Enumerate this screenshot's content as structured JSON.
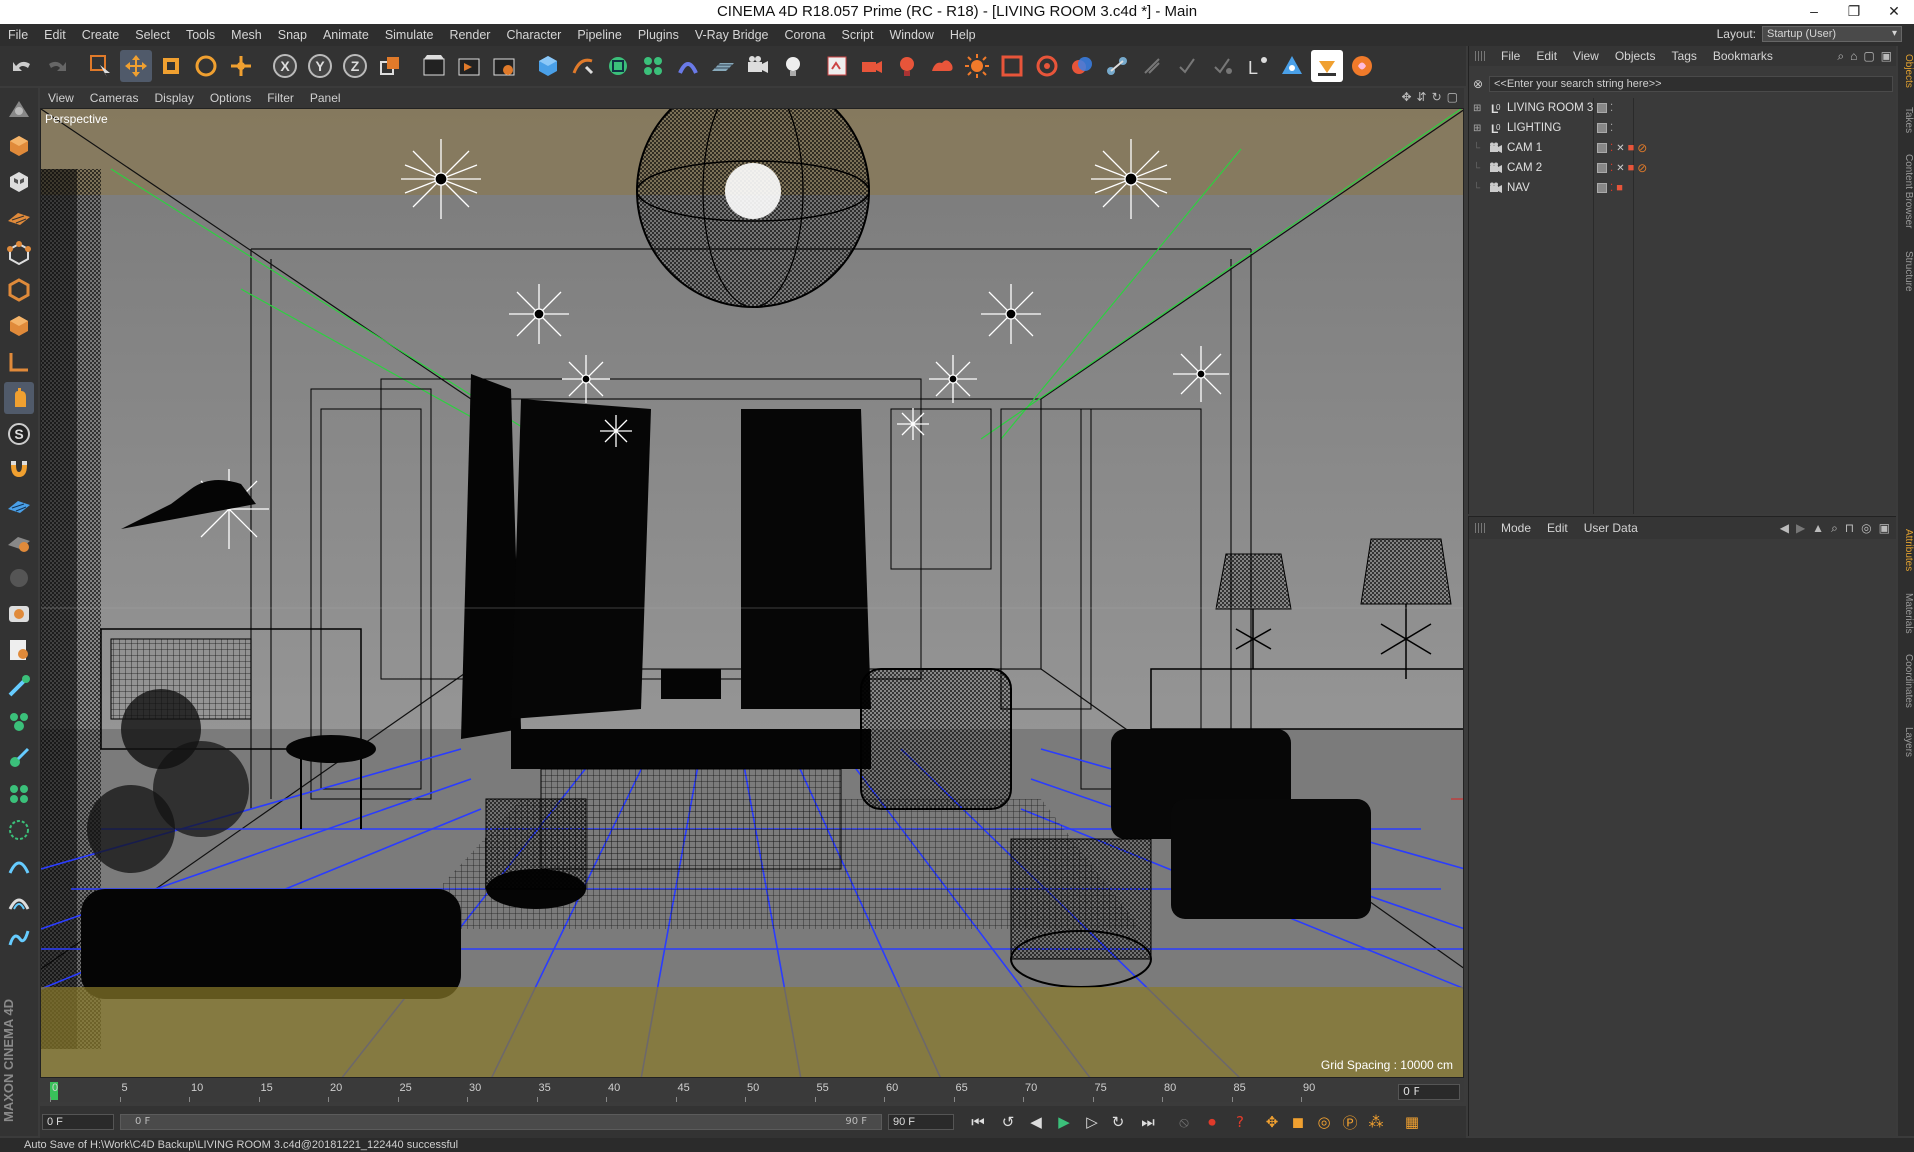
{
  "window": {
    "title": "CINEMA 4D R18.057 Prime (RC - R18) - [LIVING ROOM 3.c4d *] - Main",
    "controls": [
      "–",
      "❐",
      "✕"
    ]
  },
  "menubar": {
    "items": [
      "File",
      "Edit",
      "Create",
      "Select",
      "Tools",
      "Mesh",
      "Snap",
      "Animate",
      "Simulate",
      "Render",
      "Character",
      "Pipeline",
      "Plugins",
      "V-Ray Bridge",
      "Corona",
      "Script",
      "Window",
      "Help"
    ],
    "layout_label": "Layout:",
    "layout_value": "Startup (User)"
  },
  "toolbar": {
    "axis_x": "X",
    "axis_y": "Y",
    "axis_z": "Z"
  },
  "viewport": {
    "menu": [
      "View",
      "Cameras",
      "Display",
      "Options",
      "Filter",
      "Panel"
    ],
    "label": "Perspective",
    "grid_spacing": "Grid Spacing : 10000 cm"
  },
  "timeline": {
    "ticks": [
      "0",
      "5",
      "10",
      "15",
      "20",
      "25",
      "30",
      "35",
      "40",
      "45",
      "50",
      "55",
      "60",
      "65",
      "70",
      "75",
      "80",
      "85",
      "90"
    ],
    "current_frame": "0 F"
  },
  "transport": {
    "start_field": "0 F",
    "scrub_start": "0 F",
    "scrub_end": "90 F",
    "end_field": "90 F"
  },
  "object_manager": {
    "menu": [
      "File",
      "Edit",
      "View",
      "Objects",
      "Tags",
      "Bookmarks"
    ],
    "search_placeholder": "<<Enter your search string here>>",
    "objects": [
      {
        "name": "LIVING ROOM 3",
        "type": "null"
      },
      {
        "name": "LIGHTING",
        "type": "null"
      },
      {
        "name": "CAM 1",
        "type": "camera"
      },
      {
        "name": "CAM 2",
        "type": "camera"
      },
      {
        "name": "NAV",
        "type": "camera"
      }
    ]
  },
  "attributes": {
    "menu": [
      "Mode",
      "Edit",
      "User Data"
    ]
  },
  "side_tabs": [
    "Objects",
    "Takes",
    "Content Browser",
    "Structure",
    "Attributes",
    "Materials",
    "Coordinates",
    "Layers"
  ],
  "maxon_logo": "MAXON CINEMA 4D",
  "status": "Auto Save of H:\\Work\\C4D Backup\\LIVING ROOM 3.c4d@20181221_122440 successful",
  "colors": {
    "accent": "#e0a030",
    "viewport_bg": "#8c8c8c",
    "wire": "#000000",
    "floor_wire": "#2a3cff",
    "playhead": "#39c15a"
  }
}
